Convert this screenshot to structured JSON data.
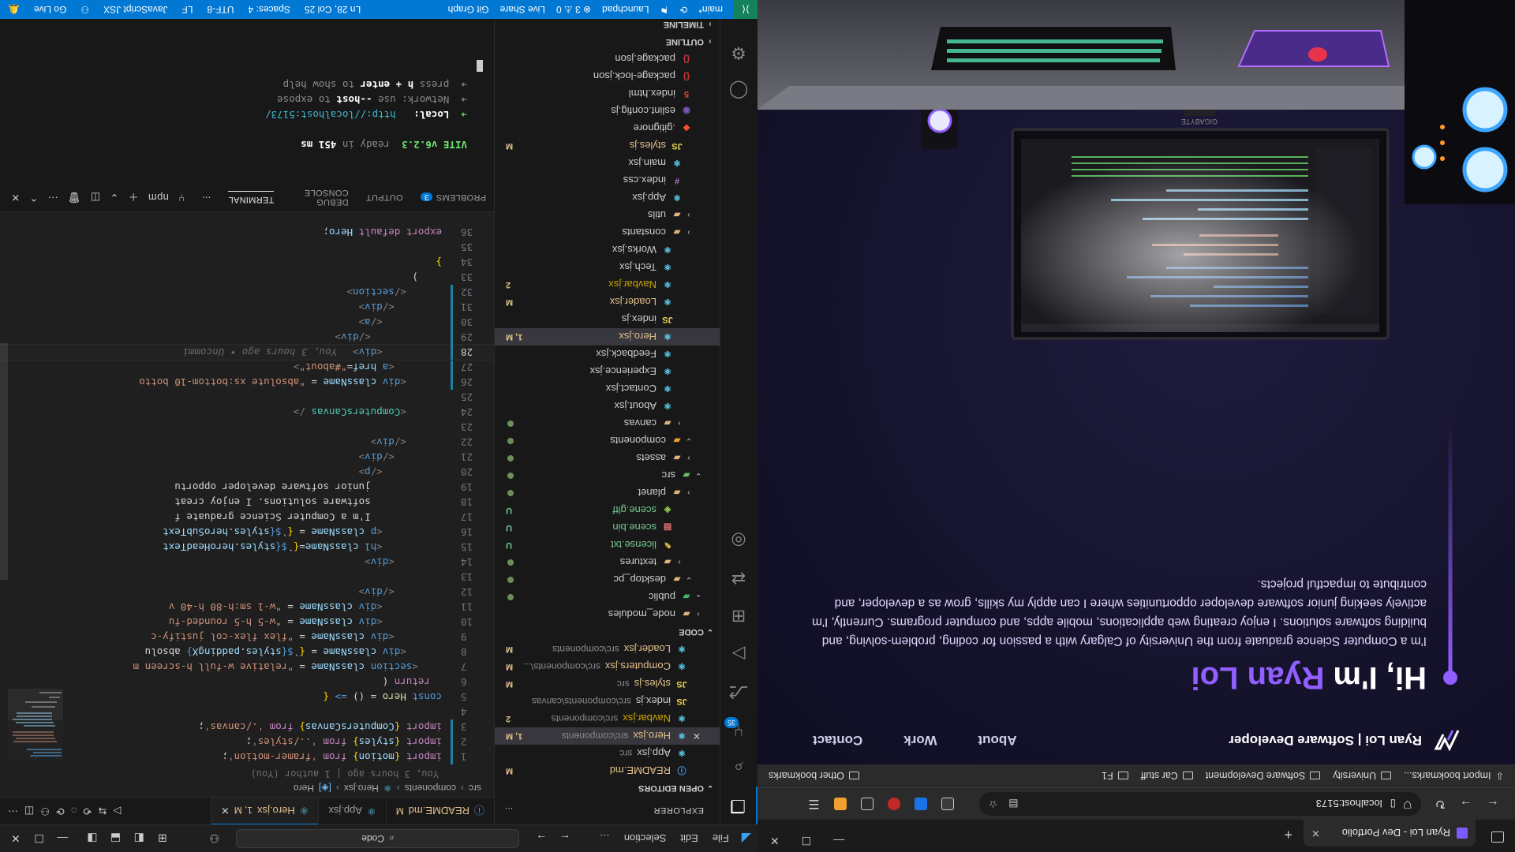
{
  "vscode": {
    "titlebar": {
      "menus": [
        "File",
        "Edit",
        "Selection"
      ],
      "more": "…",
      "search": "Code"
    },
    "activity_badge": "35",
    "explorer": {
      "title": "EXPLORER",
      "more": "…",
      "open_editors": "OPEN EDITORS",
      "open_files": [
        {
          "name": "README.md",
          "desc": "",
          "status": "M"
        },
        {
          "name": "App.jsx",
          "desc": "src",
          "status": ""
        },
        {
          "name": "Hero.jsx",
          "desc": "src\\components",
          "status": "1, M"
        },
        {
          "name": "Navbar.jsx",
          "desc": "src\\components",
          "status": "2"
        },
        {
          "name": "index.js",
          "desc": "src\\components\\canvas",
          "status": ""
        },
        {
          "name": "styles.js",
          "desc": "src",
          "status": "M"
        },
        {
          "name": "Computers.jsx",
          "desc": "src\\components\\...",
          "status": "M"
        },
        {
          "name": "Loader.jsx",
          "desc": "src\\components",
          "status": "M"
        }
      ],
      "code_section": "CODE",
      "tree": [
        {
          "name": "node_modules",
          "indent": 1,
          "kind": "folder-chev",
          "status": ""
        },
        {
          "name": "public",
          "indent": 1,
          "kind": "folder-open",
          "status": "dot"
        },
        {
          "name": "desktop_pc",
          "indent": 2,
          "kind": "folder-open",
          "status": "dot"
        },
        {
          "name": "textures",
          "indent": 3,
          "kind": "folder-chev",
          "status": "dot"
        },
        {
          "name": "license.txt",
          "indent": 3,
          "kind": "txt",
          "status": "U"
        },
        {
          "name": "scene.bin",
          "indent": 3,
          "kind": "bin",
          "status": "U"
        },
        {
          "name": "scene.gltf",
          "indent": 3,
          "kind": "glb",
          "status": "U"
        },
        {
          "name": "planet",
          "indent": 2,
          "kind": "folder-chev",
          "status": "dot"
        },
        {
          "name": "src",
          "indent": 1,
          "kind": "src-open",
          "status": "dot"
        },
        {
          "name": "assets",
          "indent": 2,
          "kind": "folder-chev",
          "status": "dot"
        },
        {
          "name": "components",
          "indent": 2,
          "kind": "comp-open",
          "status": "dot"
        },
        {
          "name": "canvas",
          "indent": 3,
          "kind": "folder-chev",
          "status": "dot"
        },
        {
          "name": "About.jsx",
          "indent": 3,
          "kind": "react",
          "status": ""
        },
        {
          "name": "Contact.jsx",
          "indent": 3,
          "kind": "react",
          "status": ""
        },
        {
          "name": "Experience.jsx",
          "indent": 3,
          "kind": "react",
          "status": ""
        },
        {
          "name": "Feedback.jsx",
          "indent": 3,
          "kind": "react",
          "status": ""
        },
        {
          "name": "Hero.jsx",
          "indent": 3,
          "kind": "react",
          "status": "1, M",
          "selected": true
        },
        {
          "name": "index.js",
          "indent": 3,
          "kind": "js",
          "status": ""
        },
        {
          "name": "Loader.jsx",
          "indent": 3,
          "kind": "react",
          "status": "M"
        },
        {
          "name": "Navbar.jsx",
          "indent": 3,
          "kind": "react",
          "status": "2"
        },
        {
          "name": "Tech.jsx",
          "indent": 3,
          "kind": "react",
          "status": ""
        },
        {
          "name": "Works.jsx",
          "indent": 3,
          "kind": "react",
          "status": ""
        },
        {
          "name": "constants",
          "indent": 2,
          "kind": "folder-chev",
          "status": ""
        },
        {
          "name": "utils",
          "indent": 2,
          "kind": "folder-chev",
          "status": ""
        },
        {
          "name": "App.jsx",
          "indent": 2,
          "kind": "react",
          "status": ""
        },
        {
          "name": "index.css",
          "indent": 2,
          "kind": "css",
          "status": ""
        },
        {
          "name": "main.jsx",
          "indent": 2,
          "kind": "react",
          "status": ""
        },
        {
          "name": "styles.js",
          "indent": 2,
          "kind": "js",
          "status": "M"
        },
        {
          "name": ".gitignore",
          "indent": 1,
          "kind": "git",
          "status": ""
        },
        {
          "name": "eslint.config.js",
          "indent": 1,
          "kind": "conf",
          "status": ""
        },
        {
          "name": "index.html",
          "indent": 1,
          "kind": "html",
          "status": ""
        },
        {
          "name": "package-lock.json",
          "indent": 1,
          "kind": "json",
          "status": ""
        },
        {
          "name": "package.json",
          "indent": 1,
          "kind": "json",
          "status": ""
        }
      ],
      "outline": "OUTLINE",
      "timeline": "TIMELINE"
    },
    "tabs": [
      {
        "name": "README.md",
        "mark": "M",
        "active": false
      },
      {
        "name": "App.jsx",
        "mark": "",
        "active": false
      },
      {
        "name": "Hero.jsx",
        "mark": "1, M",
        "active": true
      }
    ],
    "breadcrumb": [
      "src",
      "components",
      "Hero.jsx",
      "Hero"
    ],
    "blame": "You, 3 hours ago | 1 author (You)",
    "ghost_blame": "You, 3 hours ago • Uncommi",
    "code_lines": [
      {
        "n": "1",
        "html": "<span class='k'>import</span> <span class='p'>{</span><span class='v'>motion</span><span class='p'>}</span> <span class='k'>from</span> <span class='s'>'framer-motion'</span>;"
      },
      {
        "n": "2",
        "html": "<span class='k'>import</span> <span class='p'>{</span><span class='v'>styles</span><span class='p'>}</span> <span class='k'>from</span> <span class='s'>'../styles'</span>;"
      },
      {
        "n": "3",
        "html": "<span class='k'>import</span> <span class='p'>{</span><span class='v'>ComputersCanvas</span><span class='p'>}</span> <span class='k'>from</span> <span class='s'>'./canvas'</span>;"
      },
      {
        "n": "4",
        "html": ""
      },
      {
        "n": "5",
        "html": "<span class='kb'>const</span> <span class='f'>Hero</span> = () <span class='kb'>=&gt;</span> <span class='p'>{</span>"
      },
      {
        "n": "6",
        "html": "  <span class='k'>return</span> ("
      },
      {
        "n": "7",
        "html": "    <span class='g'>&lt;</span><span class='t'>section</span> <span class='a'>className</span> = <span class='s'>\"relative w-full h-screen m</span>"
      },
      {
        "n": "8",
        "html": "      <span class='g'>&lt;</span><span class='t'>div</span> <span class='a'>className</span> = <span class='p'>{</span>`<span class='kb'>${</span><span class='v'>styles</span>.<span class='v'>paddingX</span><span class='kb'>}</span> absolu"
      },
      {
        "n": "9",
        "html": "        <span class='g'>&lt;</span><span class='t'>div</span> <span class='a'>className</span> = <span class='s'>\"flex flex-col justify-c</span>"
      },
      {
        "n": "10",
        "html": "          <span class='g'>&lt;</span><span class='t'>div</span> <span class='a'>className</span> = <span class='s'>\"w-5 h-5 rounded-fu</span>"
      },
      {
        "n": "11",
        "html": "          <span class='g'>&lt;</span><span class='t'>div</span> <span class='a'>className</span> = <span class='s'>\"w-1 sm:h-80 h-40 v</span>"
      },
      {
        "n": "12",
        "html": "        <span class='g'>&lt;/</span><span class='t'>div</span><span class='g'>&gt;</span>"
      },
      {
        "n": "13",
        "html": ""
      },
      {
        "n": "14",
        "html": "        <span class='g'>&lt;</span><span class='t'>div</span><span class='g'>&gt;</span>"
      },
      {
        "n": "15",
        "html": "          <span class='g'>&lt;</span><span class='t'>h1</span> <span class='a'>className</span>=<span class='p'>{</span>`<span class='kb'>${</span><span class='v'>styles</span>.<span class='v'>heroHeadText</span>"
      },
      {
        "n": "16",
        "html": "          <span class='g'>&lt;</span><span class='t'>p</span> <span class='a'>className</span> = <span class='p'>{</span>`<span class='kb'>${</span><span class='v'>styles</span>.<span class='v'>heroSubText</span>"
      },
      {
        "n": "17",
        "html": "            I'm a Computer Science graduate f"
      },
      {
        "n": "18",
        "html": "            software solutions. I enjoy creat"
      },
      {
        "n": "19",
        "html": "            junior software developer opportu"
      },
      {
        "n": "20",
        "html": "          <span class='g'>&lt;/</span><span class='t'>p</span><span class='g'>&gt;</span>"
      },
      {
        "n": "21",
        "html": "        <span class='g'>&lt;/</span><span class='t'>div</span><span class='g'>&gt;</span>"
      },
      {
        "n": "22",
        "html": "      <span class='g'>&lt;/</span><span class='t'>div</span><span class='g'>&gt;</span>"
      },
      {
        "n": "23",
        "html": ""
      },
      {
        "n": "24",
        "html": "      <span class='g'>&lt;</span><span class='c'>ComputersCanvas</span> <span class='g'>/&gt;</span>"
      },
      {
        "n": "25",
        "html": ""
      },
      {
        "n": "26",
        "html": "      <span class='g'>&lt;</span><span class='t'>div</span> <span class='a'>className</span> = <span class='s'>\"absolute xs:bottom-10 botto</span>"
      },
      {
        "n": "27",
        "html": "        <span class='g'>&lt;</span><span class='t'>a</span> <span class='a'>href</span>=<span class='s'>\"#about\"</span><span class='g'>&gt;</span>"
      },
      {
        "n": "28",
        "html": "          <span class='g'>&lt;</span><span class='t'>div</span><span class='g'>&gt;</span>",
        "current": true
      },
      {
        "n": "29",
        "html": "            <span class='g'>&lt;/</span><span class='t'>div</span><span class='g'>&gt;</span>"
      },
      {
        "n": "30",
        "html": "          <span class='g'>&lt;/</span><span class='t'>a</span><span class='g'>&gt;</span>"
      },
      {
        "n": "31",
        "html": "        <span class='g'>&lt;/</span><span class='t'>div</span><span class='g'>&gt;</span>"
      },
      {
        "n": "32",
        "html": "      <span class='g'>&lt;/</span><span class='t'>section</span><span class='g'>&gt;</span>"
      },
      {
        "n": "33",
        "html": "    )"
      },
      {
        "n": "34",
        "html": "<span class='p'>}</span>"
      },
      {
        "n": "35",
        "html": ""
      },
      {
        "n": "36",
        "html": "<span class='k'>export</span> <span class='k'>default</span> <span class='v'>Hero</span>;"
      }
    ],
    "panel": {
      "tabs": [
        "PROBLEMS",
        "OUTPUT",
        "DEBUG CONSOLE",
        "TERMINAL"
      ],
      "problems_count": "3",
      "terminal_name": "npm",
      "terminal_lines": {
        "vite": "VITE v6.2.3",
        "ready": "ready in",
        "ready_ms": "451 ms",
        "local_label": "Local:",
        "local_url": "http://localhost:5173/",
        "network_label": "Network:",
        "network_text": "use",
        "network_flag": "--host",
        "network_tail": "to expose",
        "help_pre": "press",
        "help_key": "h + enter",
        "help_post": "to show help"
      }
    },
    "status": {
      "branch": "main*",
      "launchpad": "Launchpad",
      "problems": "⊗ 3 ⚠ 0",
      "liveshare": "Live Share",
      "gitgraph": "Git Graph",
      "position": "Ln 28, Col 25",
      "spaces": "Spaces: 4",
      "encoding": "UTF-8",
      "eol": "LF",
      "language": "JavaScript JSX",
      "golive": "Go Live"
    }
  },
  "browser": {
    "tab_title": "Ryan Loi - Dev Portfolio",
    "url": "localhost:5173",
    "bookmarks": [
      "Import bookmarks...",
      "University",
      "Software Development",
      "Car stuff",
      "F1"
    ],
    "other_bookmarks": "Other bookmarks",
    "site": {
      "brand": "Ryan Loi | Software Developer",
      "nav": [
        "About",
        "Work",
        "Contact"
      ],
      "hero_pre": "Hi, I'm ",
      "hero_name": "Ryan Loi",
      "hero_text": "I'm a Computer Science graduate from the University of Calgary with a passion for coding, problem-solving, and building software solutions. I enjoy creating web applications, mobile apps, and computer programs. Currently, I'm actively seeking junior software developer opportunities where I can apply my skills, grow as a developer, and contribute to impactful projects.",
      "accent": "#915eff",
      "monitor_label": "GIGABYTE"
    }
  }
}
